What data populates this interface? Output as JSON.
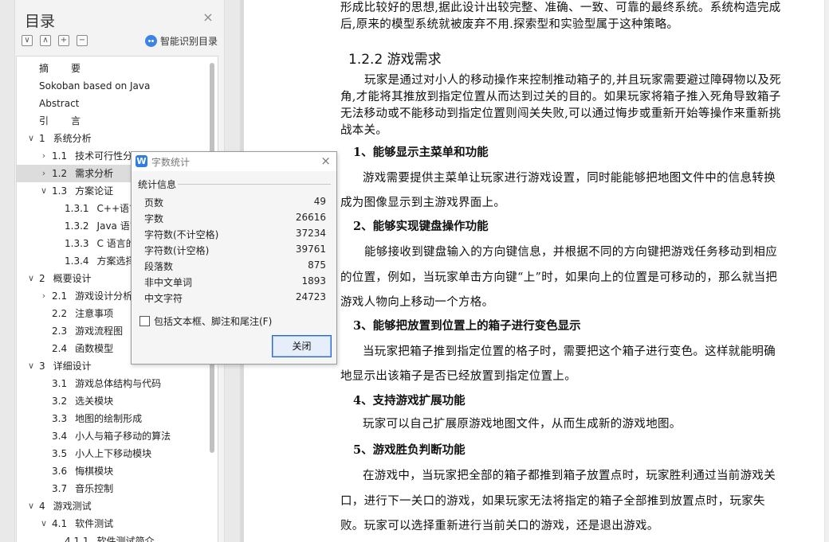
{
  "sidebar": {
    "title": "目录",
    "close_glyph": "×",
    "tools": [
      "∨",
      "∧",
      "+",
      "−"
    ],
    "smart_label": "智能识别目录",
    "items": [
      {
        "level": 0,
        "arrow": "",
        "num": "摘",
        "text": "要",
        "spaced": true
      },
      {
        "level": 0,
        "arrow": "",
        "num": "",
        "text": "Sokoban based on Java"
      },
      {
        "level": 0,
        "arrow": "",
        "num": "",
        "text": "Abstract"
      },
      {
        "level": 0,
        "arrow": "",
        "num": "引",
        "text": "言",
        "spaced": true
      },
      {
        "level": 0,
        "arrow": "∨",
        "num": "1",
        "text": "系统分析"
      },
      {
        "level": 1,
        "arrow": "›",
        "num": "1.1",
        "text": "技术可行性分"
      },
      {
        "level": 1,
        "arrow": "›",
        "num": "1.2",
        "text": "需求分析",
        "selected": true
      },
      {
        "level": 1,
        "arrow": "∨",
        "num": "1.3",
        "text": "方案论证"
      },
      {
        "level": 2,
        "arrow": "",
        "num": "1.3.1",
        "text": "C++语言"
      },
      {
        "level": 2,
        "arrow": "",
        "num": "1.3.2",
        "text": "Java 语言"
      },
      {
        "level": 2,
        "arrow": "",
        "num": "1.3.3",
        "text": "C 语言的"
      },
      {
        "level": 2,
        "arrow": "",
        "num": "1.3.4",
        "text": "方案选择"
      },
      {
        "level": 0,
        "arrow": "∨",
        "num": "2",
        "text": "概要设计"
      },
      {
        "level": 1,
        "arrow": "›",
        "num": "2.1",
        "text": "游戏设计分析"
      },
      {
        "level": 1,
        "arrow": "",
        "num": "2.2",
        "text": "注意事项"
      },
      {
        "level": 1,
        "arrow": "",
        "num": "2.3",
        "text": "游戏流程图"
      },
      {
        "level": 1,
        "arrow": "",
        "num": "2.4",
        "text": "函数模型"
      },
      {
        "level": 0,
        "arrow": "∨",
        "num": "3",
        "text": "详细设计"
      },
      {
        "level": 1,
        "arrow": "",
        "num": "3.1",
        "text": "游戏总体结构与代码"
      },
      {
        "level": 1,
        "arrow": "",
        "num": "3.2",
        "text": "选关模块"
      },
      {
        "level": 1,
        "arrow": "",
        "num": "3.3",
        "text": "地图的绘制形成"
      },
      {
        "level": 1,
        "arrow": "",
        "num": "3.4",
        "text": "小人与箱子移动的算法"
      },
      {
        "level": 1,
        "arrow": "",
        "num": "3.5",
        "text": "小人上下移动模块"
      },
      {
        "level": 1,
        "arrow": "",
        "num": "3.6",
        "text": "悔棋模块"
      },
      {
        "level": 1,
        "arrow": "",
        "num": "3.7",
        "text": "音乐控制"
      },
      {
        "level": 0,
        "arrow": "∨",
        "num": "4",
        "text": "游戏测试"
      },
      {
        "level": 1,
        "arrow": "∨",
        "num": "4.1",
        "text": "软件测试"
      },
      {
        "level": 2,
        "arrow": "",
        "num": "4.1.1",
        "text": "软件测试简介"
      }
    ]
  },
  "document": {
    "intro": "形成比较好的思想,据此设计出较完整、准确、一致、可靠的最终系统。系统构造完成后,原来的模型系统就被废弃不用.探索型和实验型属于这种策略。",
    "heading": "1.2.2   游戏需求",
    "p1": "玩家是通过对小人的移动操作来控制推动箱子的,并且玩家需要避过障碍物以及死角,才能将其推放到指定位置从而达到过关的目的。如果玩家将箱子推入死角导致箱子无法移动或不能移动到指定位置则闯关失败,可以通过悔步或重新开始等操作来重新挑战本关。",
    "h_1": "1、能够显示主菜单和功能",
    "p_1": "游戏需要提供主菜单让玩家进行游戏设置，同时能能够把地图文件中的信息转换成为图像显示到主游戏界面上。",
    "h_2": "2、能够实现键盘操作功能",
    "p_2": "能够接收到键盘输入的方向键信息，并根据不同的方向键把游戏任务移动到相应的位置，例如，当玩家单击方向键“上”时，如果向上的位置是可移动的，那么就当把游戏人物向上移动一个方格。",
    "h_3": "3、能够把放置到位置上的箱子进行变色显示",
    "p_3": "当玩家把箱子推到指定位置的格子时，需要把这个箱子进行变色。这样就能明确地显示出该箱子是否已经放置到指定位置上。",
    "h_4": "4、支持游戏扩展功能",
    "p_4": "玩家可以自己扩展原游戏地图文件，从而生成新的游戏地图。",
    "h_5": "5、游戏胜负判断功能",
    "p_5": "在游戏中，当玩家把全部的箱子都推到箱子放置点时，玩家胜利通过当前游戏关口，进行下一关口的游戏，如果玩家无法将指定的箱子全部推到放置点时，玩家失败。玩家可以选择重新进行当前关口的游戏，还是退出游戏。"
  },
  "dialog": {
    "logo": "W",
    "title": "字数统计",
    "close_glyph": "×",
    "group_label": "统计信息",
    "stats": [
      {
        "label": "页数",
        "value": "49"
      },
      {
        "label": "字数",
        "value": "26616"
      },
      {
        "label": "字符数(不计空格)",
        "value": "37234"
      },
      {
        "label": "字符数(计空格)",
        "value": "39761"
      },
      {
        "label": "段落数",
        "value": "875"
      },
      {
        "label": "非中文单词",
        "value": "1893"
      },
      {
        "label": "中文字符",
        "value": "24723"
      }
    ],
    "checkbox_label": "包括文本框、脚注和尾注(F)",
    "close_button": "关闭"
  }
}
